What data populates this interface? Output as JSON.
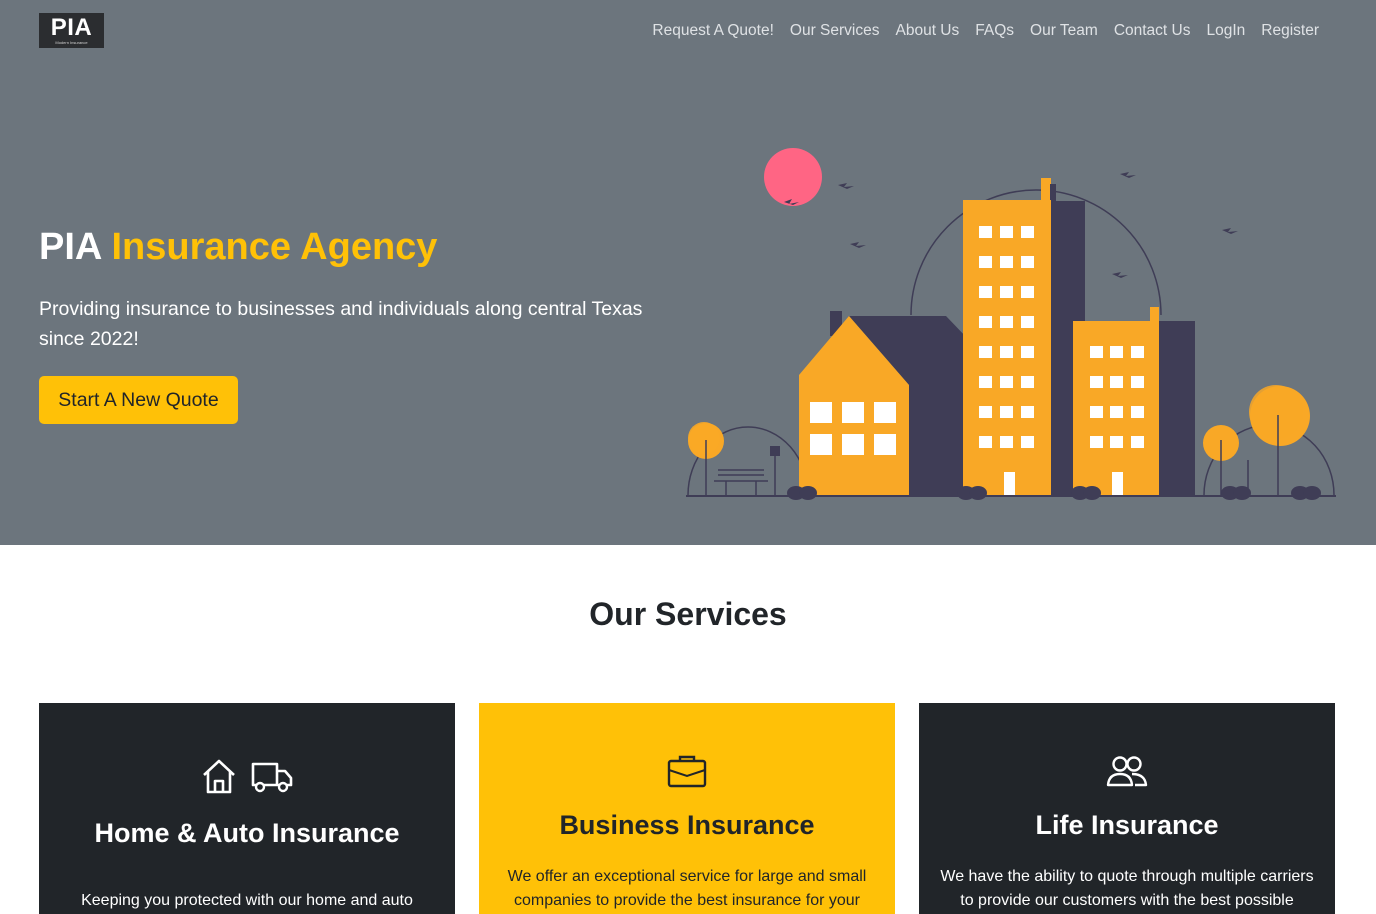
{
  "brand": {
    "logo_text": "PIA",
    "logo_subtext": "Modern Insurance"
  },
  "nav": {
    "items": [
      {
        "label": "Request A Quote!"
      },
      {
        "label": "Our Services"
      },
      {
        "label": "About Us"
      },
      {
        "label": "FAQs"
      },
      {
        "label": "Our Team"
      },
      {
        "label": "Contact Us"
      },
      {
        "label": "LogIn"
      },
      {
        "label": "Register"
      }
    ]
  },
  "hero": {
    "title_main": "PIA",
    "title_accent": "Insurance Agency",
    "text": "Providing insurance to businesses and individuals along central Texas since 2022!",
    "button_label": "Start A New Quote"
  },
  "services": {
    "title": "Our Services",
    "cards": [
      {
        "title": "Home & Auto Insurance",
        "text": "Keeping you protected with our home and auto",
        "icons": [
          "house-icon",
          "truck-icon"
        ]
      },
      {
        "title": "Business Insurance",
        "text": "We offer an exceptional service for large and small companies to provide the best insurance for your",
        "icons": [
          "briefcase-icon"
        ]
      },
      {
        "title": "Life Insurance",
        "text": "We have the ability to quote through multiple carriers to provide our customers with the best possible",
        "icons": [
          "people-icon"
        ]
      }
    ]
  },
  "colors": {
    "hero_bg": "#6c757d",
    "accent": "#ffc107",
    "dark": "#212529",
    "illustration_orange": "#f9a826",
    "illustration_navy": "#3f3d56",
    "sun_pink": "#ff6584"
  }
}
